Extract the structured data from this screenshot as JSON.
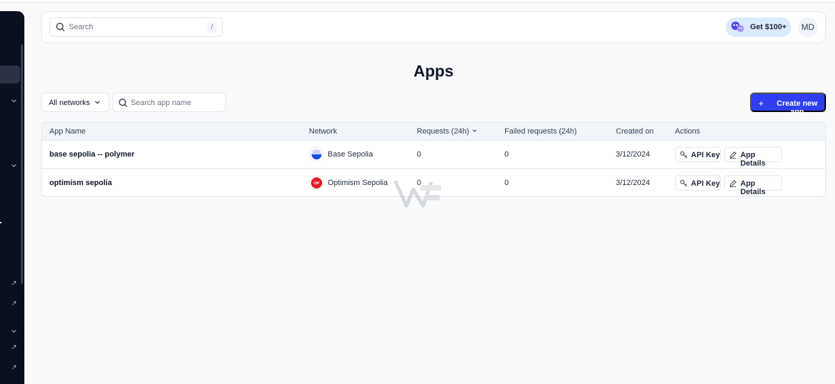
{
  "header": {
    "search_placeholder": "Search",
    "search_shortcut": "/",
    "promo_label": "Get $100+",
    "user_initials": "MD"
  },
  "page": {
    "title": "Apps"
  },
  "filters": {
    "network_selected": "All networks",
    "app_search_placeholder": "Search app name",
    "create_button_label": "Create new app"
  },
  "table": {
    "headers": {
      "app_name": "App Name",
      "network": "Network",
      "requests": "Requests (24h)",
      "failed": "Failed requests (24h)",
      "created": "Created on",
      "actions": "Actions"
    },
    "rows": [
      {
        "app_name": "base sepolia -- polymer",
        "network": "Base Sepolia",
        "network_icon": "base-logo",
        "requests": "0",
        "failed": "0",
        "created": "3/12/2024",
        "api_key_label": "API Key",
        "details_label": "App Details"
      },
      {
        "app_name": "optimism sepolia",
        "network": "Optimism Sepolia",
        "network_icon": "optimism-logo",
        "requests": "0",
        "failed": "0",
        "created": "3/12/2024",
        "api_key_label": "API Key",
        "details_label": "App Details"
      }
    ]
  },
  "colors": {
    "primary": "#2f3ff0",
    "sidebar": "#0b1020",
    "background": "#f8fafc",
    "optimism_red": "#e11d2a"
  }
}
